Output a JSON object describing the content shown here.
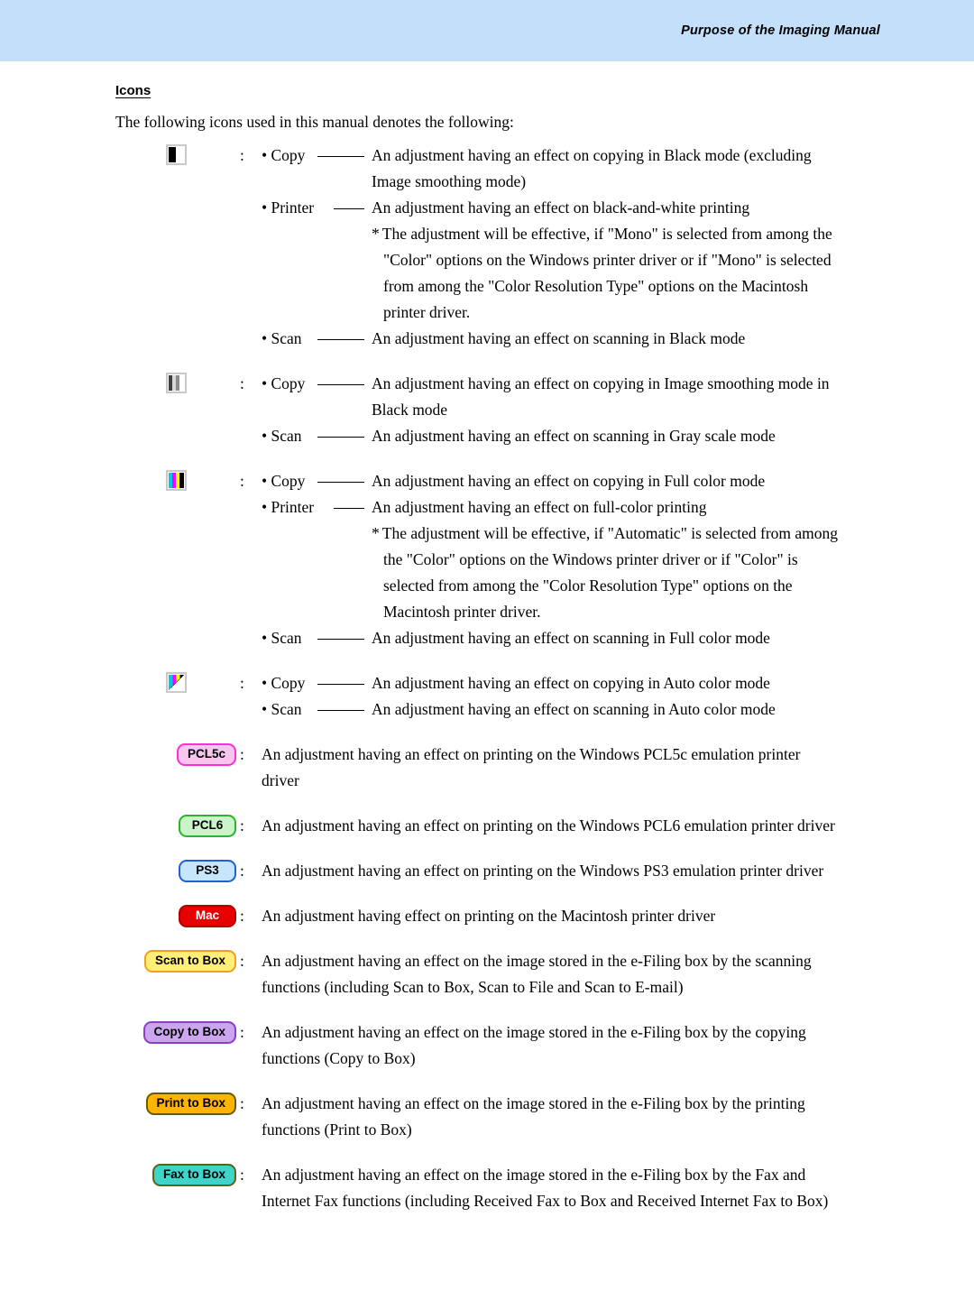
{
  "header": {
    "title": "Purpose of the Imaging Manual",
    "band_color": "#c3dffa"
  },
  "section": {
    "title": "Icons",
    "intro": "The following icons used in this manual denotes the following:"
  },
  "labels": {
    "colon": ":",
    "copy": "• Copy",
    "printer": "• Printer",
    "scan": "• Scan",
    "star": "*"
  },
  "entries": [
    {
      "icon_name": "black-mode-swatch-icon",
      "icon_type": "swatch",
      "icon_colors": [
        "#000000",
        "#ffffff"
      ],
      "lines": [
        {
          "kind": "sub",
          "label": "• Copy",
          "text": "An adjustment having an effect on copying in Black mode (excluding"
        },
        {
          "kind": "cont",
          "text": "Image smoothing mode)"
        },
        {
          "kind": "sub",
          "label": "• Printer",
          "text": "An adjustment having an effect on black-and-white printing"
        },
        {
          "kind": "note",
          "text": "The adjustment will be effective, if \"Mono\" is selected from among the"
        },
        {
          "kind": "note-cont",
          "text": "\"Color\" options on the Windows printer driver or if \"Mono\" is selected"
        },
        {
          "kind": "note-cont",
          "text": "from among the \"Color Resolution Type\" options on the Macintosh"
        },
        {
          "kind": "note-cont",
          "text": "printer driver."
        },
        {
          "kind": "sub",
          "label": "• Scan",
          "text": "An adjustment having an effect on scanning in Black mode"
        }
      ]
    },
    {
      "icon_name": "gray-scale-swatch-icon",
      "icon_type": "swatch",
      "icon_colors": [
        "#404040",
        "#d9d9d9",
        "#8c8c8c",
        "#ffffff"
      ],
      "lines": [
        {
          "kind": "sub",
          "label": "• Copy",
          "text": "An adjustment having an effect on copying in Image smoothing mode in"
        },
        {
          "kind": "cont",
          "text": "Black mode"
        },
        {
          "kind": "sub",
          "label": "• Scan",
          "text": "An adjustment having an effect on scanning in Gray scale mode"
        }
      ]
    },
    {
      "icon_name": "full-color-swatch-icon",
      "icon_type": "swatch",
      "icon_colors": [
        "#00c8e6",
        "#ff00ff",
        "#ffff00",
        "#000000"
      ],
      "lines": [
        {
          "kind": "sub",
          "label": "• Copy",
          "text": "An adjustment having an effect on copying in Full color mode"
        },
        {
          "kind": "sub",
          "label": "• Printer",
          "text": "An adjustment having an effect on full-color printing"
        },
        {
          "kind": "note",
          "text": "The adjustment will be effective, if \"Automatic\" is selected from among"
        },
        {
          "kind": "note-cont",
          "text": "the \"Color\" options on the Windows printer driver or if \"Color\" is"
        },
        {
          "kind": "note-cont",
          "text": "selected from among the \"Color Resolution Type\" options on the"
        },
        {
          "kind": "note-cont",
          "text": "Macintosh printer driver."
        },
        {
          "kind": "sub",
          "label": "• Scan",
          "text": "An adjustment having an effect on scanning in Full color mode"
        }
      ]
    },
    {
      "icon_name": "auto-color-swatch-icon",
      "icon_type": "swatch-diagonal",
      "icon_colors": [
        "#00c8e6",
        "#ff00ff",
        "#ffff00",
        "#000000"
      ],
      "lines": [
        {
          "kind": "sub",
          "label": "• Copy",
          "text": "An adjustment having an effect on copying in Auto color mode"
        },
        {
          "kind": "sub",
          "label": "• Scan",
          "text": "An adjustment having an effect on scanning in Auto color mode"
        }
      ]
    },
    {
      "icon_name": "pcl5c-badge",
      "icon_type": "badge",
      "badge_label": "PCL5c",
      "badge_fill": "#f7c6ef",
      "badge_border": "#ff2fd8",
      "badge_text_color": "#000000",
      "lines": [
        {
          "kind": "plain",
          "text": "An adjustment having an effect on printing on the Windows PCL5c emulation printer"
        },
        {
          "kind": "plain",
          "text": "driver"
        }
      ]
    },
    {
      "icon_name": "pcl6-badge",
      "icon_type": "badge",
      "badge_label": "PCL6",
      "badge_fill": "#c9f5c9",
      "badge_border": "#2ab52a",
      "badge_text_color": "#000000",
      "lines": [
        {
          "kind": "plain",
          "text": "An adjustment having an effect on printing on the Windows PCL6 emulation printer driver"
        }
      ]
    },
    {
      "icon_name": "ps3-badge",
      "icon_type": "badge",
      "badge_label": "PS3",
      "badge_fill": "#c6e7fb",
      "badge_border": "#1f5fd8",
      "badge_text_color": "#000000",
      "lines": [
        {
          "kind": "plain",
          "text": "An adjustment having an effect on printing on the Windows PS3 emulation printer driver"
        }
      ]
    },
    {
      "icon_name": "mac-badge",
      "icon_type": "badge",
      "badge_label": "Mac",
      "badge_fill": "#e60000",
      "badge_border": "#b00000",
      "badge_text_color": "#ffffff",
      "lines": [
        {
          "kind": "plain",
          "text": "An adjustment having effect on printing on the Macintosh printer driver"
        }
      ]
    },
    {
      "icon_name": "scan-to-box-badge",
      "icon_type": "badge",
      "badge_label": "Scan to Box",
      "badge_fill": "#ffef7a",
      "badge_border": "#f0a020",
      "badge_text_color": "#000000",
      "lines": [
        {
          "kind": "plain",
          "text": "An adjustment having an effect on the image stored in the e-Filing box by the scanning"
        },
        {
          "kind": "plain",
          "text": "functions (including Scan to Box, Scan to File and Scan to E-mail)"
        }
      ]
    },
    {
      "icon_name": "copy-to-box-badge",
      "icon_type": "badge",
      "badge_label": "Copy to Box",
      "badge_fill": "#cba6ee",
      "badge_border": "#8b3fc4",
      "badge_text_color": "#000000",
      "lines": [
        {
          "kind": "plain",
          "text": "An adjustment having an effect on the image stored in the e-Filing box by the copying"
        },
        {
          "kind": "plain",
          "text": "functions (Copy to Box)"
        }
      ]
    },
    {
      "icon_name": "print-to-box-badge",
      "icon_type": "badge",
      "badge_label": "Print to Box",
      "badge_fill": "#ffb400",
      "badge_border": "#6b5a00",
      "badge_text_color": "#000000",
      "lines": [
        {
          "kind": "plain",
          "text": "An adjustment having an effect on the image stored in the e-Filing box by the printing"
        },
        {
          "kind": "plain",
          "text": "functions (Print to Box)"
        }
      ]
    },
    {
      "icon_name": "fax-to-box-badge",
      "icon_type": "badge",
      "badge_label": "Fax to Box",
      "badge_fill": "#3fd4ca",
      "badge_border": "#55661a",
      "badge_text_color": "#000000",
      "lines": [
        {
          "kind": "plain",
          "text": "An adjustment having an effect on the image stored in the e-Filing box by the Fax and"
        },
        {
          "kind": "plain",
          "text": "Internet Fax functions (including Received Fax to Box and Received Internet Fax to Box)"
        }
      ]
    }
  ]
}
